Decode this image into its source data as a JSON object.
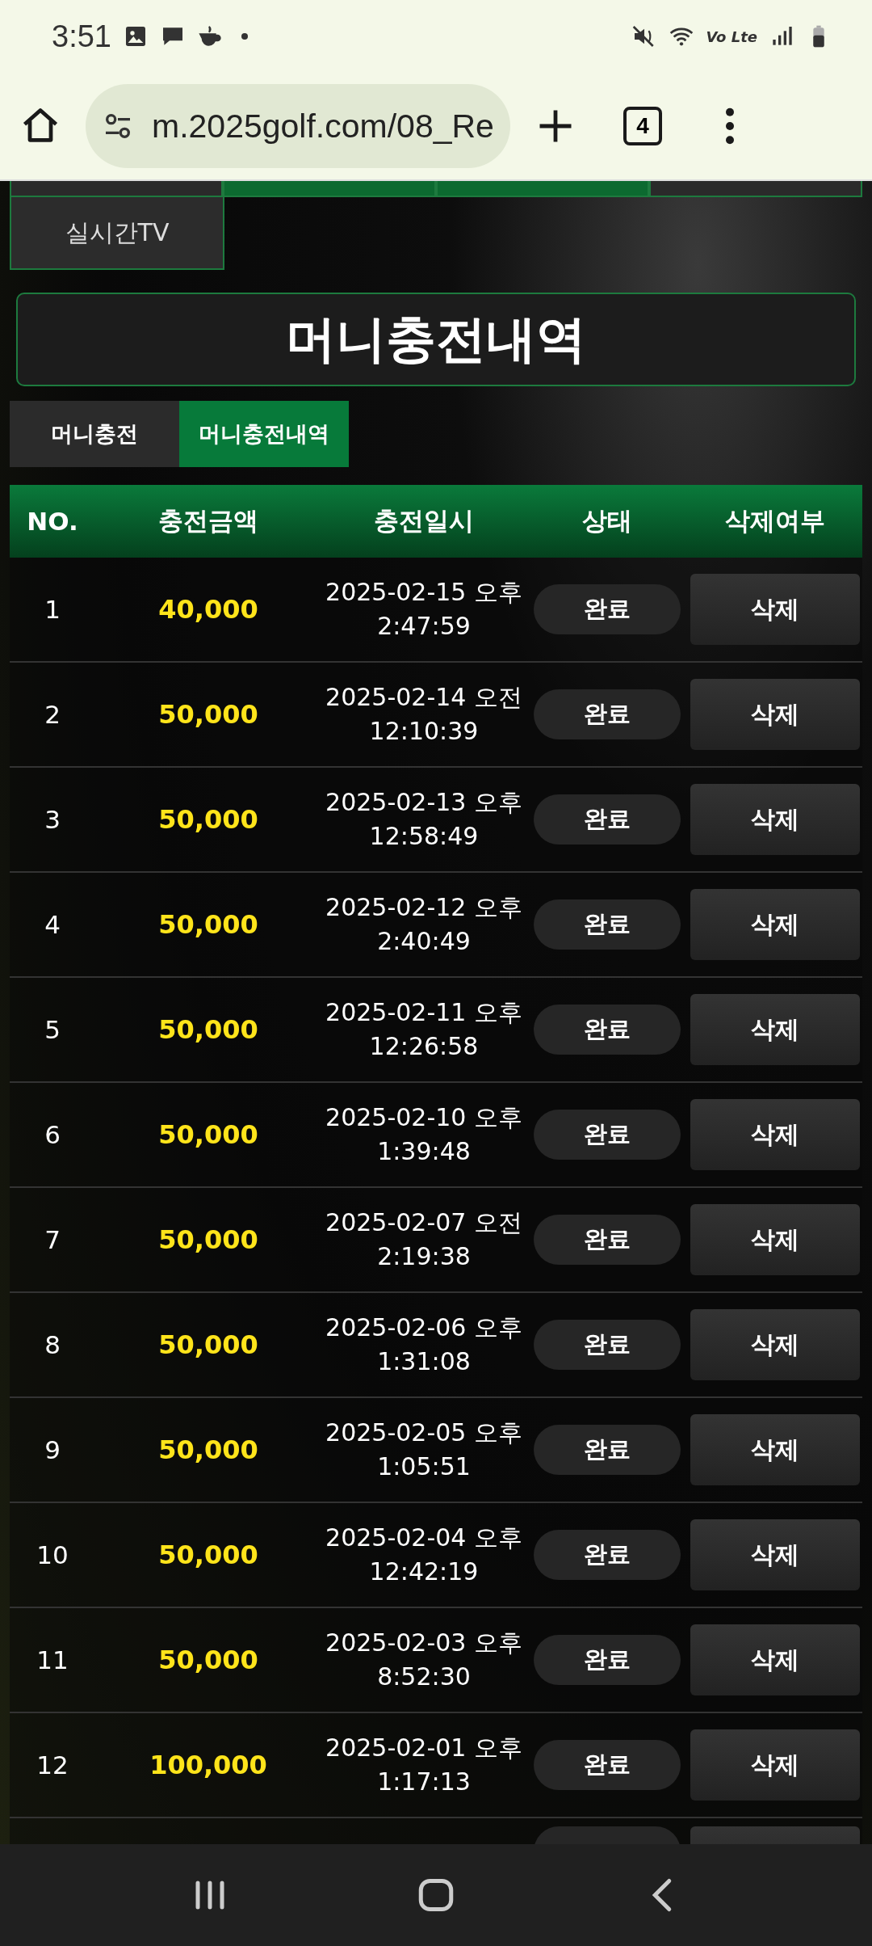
{
  "status_bar": {
    "time": "3:51",
    "network_label": "Vo Lte"
  },
  "browser": {
    "url": "m.2025golf.com/08_Re",
    "tab_count": "4"
  },
  "top_menu": [
    {
      "highlighted": false
    },
    {
      "highlighted": true
    },
    {
      "highlighted": true
    },
    {
      "highlighted": false
    }
  ],
  "side_menu": {
    "label": "실시간TV"
  },
  "page_title": "머니충전내역",
  "tabs": [
    {
      "label": "머니충전",
      "selected": false
    },
    {
      "label": "머니충전내역",
      "selected": true
    }
  ],
  "table": {
    "columns": [
      "NO.",
      "충전금액",
      "충전일시",
      "상태",
      "삭제여부"
    ],
    "rows": [
      {
        "no": "1",
        "amount": "40,000",
        "date": "2025-02-15 오후",
        "time": "2:47:59",
        "status": "완료",
        "action": "삭제"
      },
      {
        "no": "2",
        "amount": "50,000",
        "date": "2025-02-14 오전",
        "time": "12:10:39",
        "status": "완료",
        "action": "삭제"
      },
      {
        "no": "3",
        "amount": "50,000",
        "date": "2025-02-13 오후",
        "time": "12:58:49",
        "status": "완료",
        "action": "삭제"
      },
      {
        "no": "4",
        "amount": "50,000",
        "date": "2025-02-12 오후",
        "time": "2:40:49",
        "status": "완료",
        "action": "삭제"
      },
      {
        "no": "5",
        "amount": "50,000",
        "date": "2025-02-11 오후",
        "time": "12:26:58",
        "status": "완료",
        "action": "삭제"
      },
      {
        "no": "6",
        "amount": "50,000",
        "date": "2025-02-10 오후",
        "time": "1:39:48",
        "status": "완료",
        "action": "삭제"
      },
      {
        "no": "7",
        "amount": "50,000",
        "date": "2025-02-07 오전",
        "time": "2:19:38",
        "status": "완료",
        "action": "삭제"
      },
      {
        "no": "8",
        "amount": "50,000",
        "date": "2025-02-06 오후",
        "time": "1:31:08",
        "status": "완료",
        "action": "삭제"
      },
      {
        "no": "9",
        "amount": "50,000",
        "date": "2025-02-05 오후",
        "time": "1:05:51",
        "status": "완료",
        "action": "삭제"
      },
      {
        "no": "10",
        "amount": "50,000",
        "date": "2025-02-04 오후",
        "time": "12:42:19",
        "status": "완료",
        "action": "삭제"
      },
      {
        "no": "11",
        "amount": "50,000",
        "date": "2025-02-03 오후",
        "time": "8:52:30",
        "status": "완료",
        "action": "삭제"
      },
      {
        "no": "12",
        "amount": "100,000",
        "date": "2025-02-01 오후",
        "time": "1:17:13",
        "status": "완료",
        "action": "삭제"
      }
    ]
  }
}
